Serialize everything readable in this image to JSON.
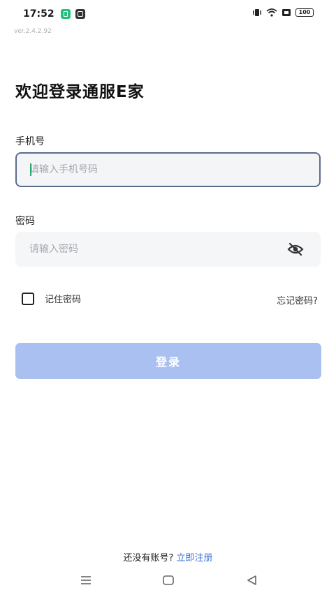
{
  "status_bar": {
    "time": "17:52",
    "battery_level": "100",
    "icons": [
      "green-notification-icon",
      "dark-notification-icon",
      "vibrate-icon",
      "wifi-icon",
      "sim-icon",
      "battery-icon"
    ]
  },
  "app": {
    "version": "ver.2.4.2.92",
    "title": "欢迎登录通服E家"
  },
  "form": {
    "phone": {
      "label": "手机号",
      "placeholder": "请输入手机号码",
      "value": ""
    },
    "password": {
      "label": "密码",
      "placeholder": "请输入密码",
      "value": "",
      "toggle_icon": "eye-off-icon"
    },
    "remember_label": "记住密码",
    "remember_checked": false,
    "forgot_label": "忘记密码?",
    "login_label": "登录"
  },
  "footer": {
    "prompt": "还没有账号?",
    "register_link": "立即注册"
  },
  "nav": {
    "icons": [
      "menu-icon",
      "home-icon",
      "back-icon"
    ]
  },
  "colors": {
    "primary_button": "#a9c0f0",
    "link": "#3d6fd9",
    "input_focus_border": "#5c6b8c",
    "caret": "#2aa874"
  }
}
